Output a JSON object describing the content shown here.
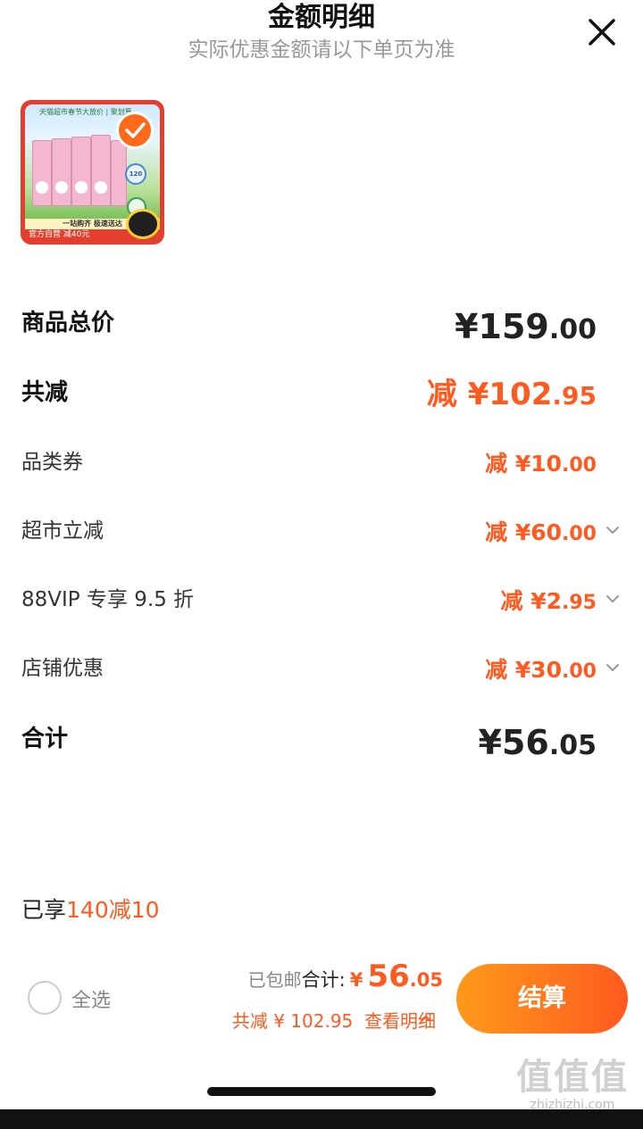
{
  "header": {
    "title": "金额明细",
    "subtitle": "实际优惠金额请以下单页为准"
  },
  "product": {
    "banner_text": "天猫超市春节大放价 | 聚划算",
    "capacity_badge": "120",
    "strip_text": "一站购齐 极速送达",
    "tag_text": "官方自营 减40元"
  },
  "rows": [
    {
      "label": "商品总价",
      "currency": "¥",
      "int": "159",
      "dec": ".00"
    },
    {
      "label": "共减",
      "prefix": "减",
      "currency": "¥",
      "int": "102",
      "dec": ".95"
    },
    {
      "label": "品类券",
      "prefix": "减",
      "currency": "¥",
      "int": "10",
      "dec": ".00"
    },
    {
      "label": "超市立减",
      "prefix": "减",
      "currency": "¥",
      "int": "60",
      "dec": ".00"
    },
    {
      "label": "88VIP 专享 9.5 折",
      "prefix": "减",
      "currency": "¥",
      "int": "2",
      "dec": ".95"
    },
    {
      "label": "店铺优惠",
      "prefix": "减",
      "currency": "¥",
      "int": "30",
      "dec": ".00"
    },
    {
      "label": "合计",
      "currency": "¥",
      "int": "56",
      "dec": ".05"
    }
  ],
  "promo": {
    "prefix": "已享",
    "highlight": "140减10"
  },
  "footer": {
    "select_all": "全选",
    "shipping": "已包邮",
    "total_label": "合计:",
    "currency": "¥",
    "total_int": "56",
    "total_dec": ".05",
    "saving_text": "共减 ¥ 102.95",
    "view_detail": "查看明细",
    "checkout_label": "结算"
  },
  "watermark": {
    "logo": "值值值",
    "url": "zhizhizhi.com"
  },
  "colors": {
    "accent": "#ff5a1f",
    "checkout_start": "#ff9a1a",
    "checkout_end": "#ff5a1f",
    "muted": "#999999"
  },
  "icons": [
    "close-icon",
    "checkmark-icon",
    "chevron-down-icon",
    "chevron-up-icon",
    "radio-icon"
  ]
}
